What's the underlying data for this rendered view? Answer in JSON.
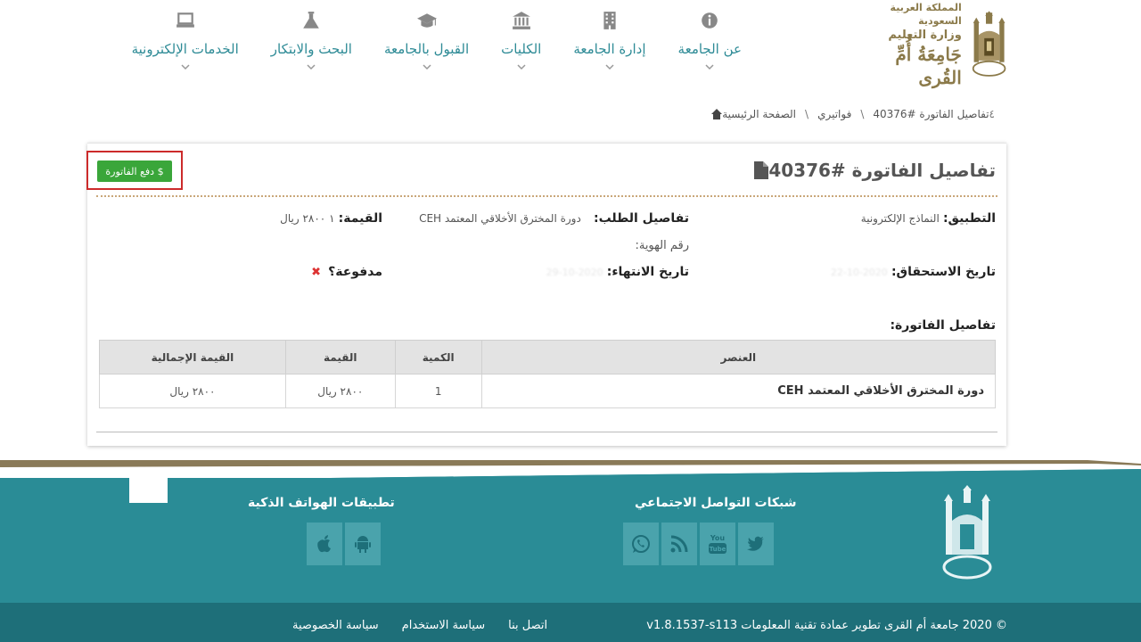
{
  "logo": {
    "line1": "المملكة العربية السعودية",
    "line2": "وزارة التعليم",
    "line3": "جَامِعَةُ أُمِّ القُرى"
  },
  "nav": {
    "items": [
      {
        "label": "عن الجامعة",
        "icon": "info-icon"
      },
      {
        "label": "إدارة الجامعة",
        "icon": "building-icon"
      },
      {
        "label": "الكليات",
        "icon": "institution-icon"
      },
      {
        "label": "القبول بالجامعة",
        "icon": "graduation-cap-icon"
      },
      {
        "label": "البحث والابتكار",
        "icon": "flask-icon"
      },
      {
        "label": "الخدمات الإلكترونية",
        "icon": "laptop-icon"
      }
    ]
  },
  "breadcrumb": {
    "home": "الصفحة الرئيسية",
    "invoices": "فواتيري",
    "current": "تفاصيل الفاتورة #40376",
    "extra": "٤"
  },
  "invoice": {
    "title": "تفاصيل الفاتورة #40376",
    "pay_button": "$ دفع الفاتورة",
    "application_label": "التطبيق:",
    "application_value": "النماذج الإلكترونية",
    "request_label": "تفاصيل الطلب:",
    "request_value": "دورة المخترق الأخلاقي المعتمد CEH",
    "id_label": "رقم الهوية:",
    "amount_label": "القيمة:",
    "amount_value": "١ ٢٨٠٠ ريال",
    "due_label": "تاريخ الاستحقاق:",
    "due_value": "2020-10-22",
    "end_label": "تاريخ الانتهاء:",
    "end_value": "2020-10-29",
    "paid_label": "مدفوعة؟",
    "paid_mark": "✖",
    "details_title": "تفاصيل الفاتورة:",
    "table": {
      "headers": [
        "العنصر",
        "الكمية",
        "القيمة",
        "القيمة الإجمالية"
      ],
      "rows": [
        {
          "item": "دورة المخترق الأخلاقي المعتمد CEH",
          "qty": "1",
          "price": "٢٨٠٠ ريال",
          "total": "٢٨٠٠ ريال"
        }
      ]
    }
  },
  "footer": {
    "social_title": "شبكات التواصل الاجتماعي",
    "apps_title": "تطبيقات الهواتف الذكية",
    "copyright": "© 2020 جامعة أم القرى تطوير عمادة تقنية المعلومات v1.8.1537-s113",
    "links": [
      "سياسة الخصوصية",
      "سياسة الاستخدام",
      "اتصل بنا"
    ]
  },
  "colors": {
    "teal": "#2a8c96",
    "dark_teal": "#1e6f79",
    "gold": "#8b7a4a",
    "green": "#3aa63a",
    "red": "#cc2b2b"
  }
}
